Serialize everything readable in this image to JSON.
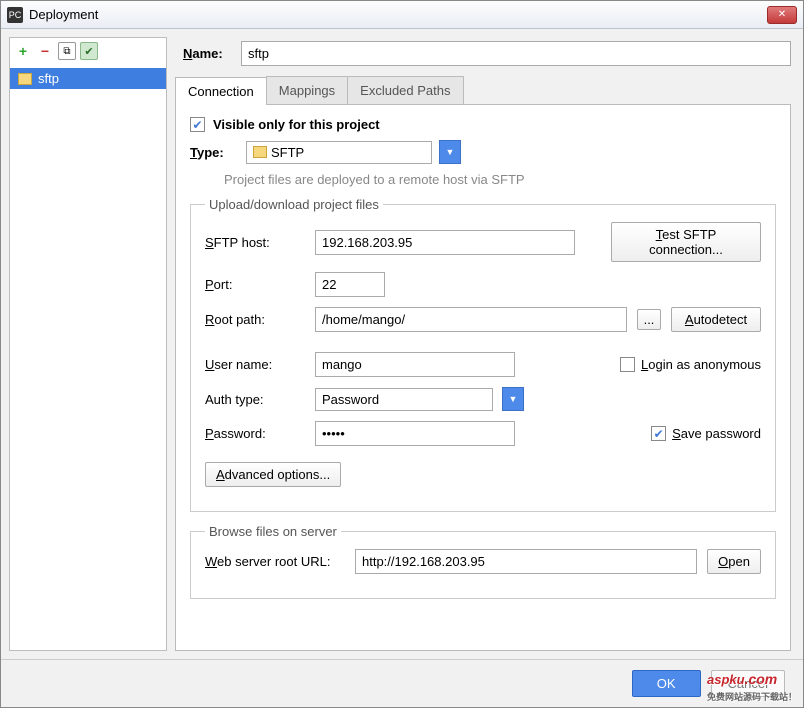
{
  "window": {
    "title": "Deployment"
  },
  "sidebar": {
    "items": [
      {
        "label": "sftp"
      }
    ]
  },
  "name": {
    "label": "Name:",
    "value": "sftp"
  },
  "tabs": [
    "Connection",
    "Mappings",
    "Excluded Paths"
  ],
  "visible_only": {
    "label": "Visible only for this project",
    "checked": true
  },
  "type": {
    "label": "Type:",
    "value": "SFTP",
    "hint": "Project files are deployed to a remote host via SFTP"
  },
  "upload_group": "Upload/download project files",
  "fields": {
    "host_label": "SFTP host:",
    "host": "192.168.203.95",
    "test_btn": "Test SFTP connection...",
    "port_label": "Port:",
    "port": "22",
    "root_label": "Root path:",
    "root": "/home/mango/",
    "browse_btn": "...",
    "autodetect_btn": "Autodetect",
    "user_label": "User name:",
    "user": "mango",
    "anon_label": "Login as anonymous",
    "anon_checked": false,
    "auth_label": "Auth type:",
    "auth": "Password",
    "pwd_label": "Password:",
    "pwd": "•••••",
    "save_pwd_label": "Save password",
    "save_pwd_checked": true,
    "advanced_btn": "Advanced options..."
  },
  "browse_group": "Browse files on server",
  "weburl": {
    "label": "Web server root URL:",
    "value": "http://192.168.203.95",
    "open_btn": "Open"
  },
  "footer": {
    "ok": "OK",
    "cancel": "Cancel"
  },
  "watermark": {
    "big": "aspku",
    "small": "免费网站源码下载站！",
    "suffix": ".com"
  }
}
